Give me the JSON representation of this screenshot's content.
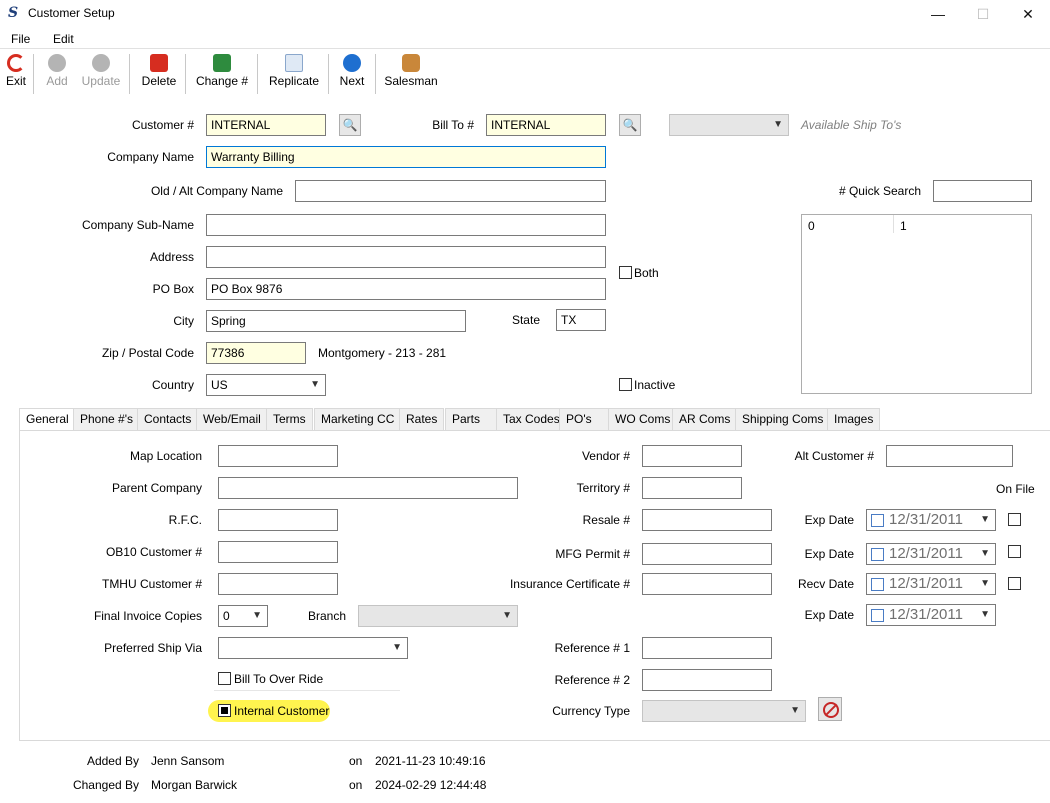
{
  "window": {
    "title": "Customer Setup",
    "app_icon": "S"
  },
  "window_controls": {
    "minimize": "—",
    "maximize": "☐",
    "close": "✕"
  },
  "menu": {
    "file": "File",
    "edit": "Edit"
  },
  "toolbar": {
    "exit": "Exit",
    "add": "Add",
    "update": "Update",
    "delete": "Delete",
    "change": "Change #",
    "replicate": "Replicate",
    "next": "Next",
    "salesman": "Salesman"
  },
  "header": {
    "customer_no_label": "Customer #",
    "customer_no": "INTERNAL",
    "bill_to_label": "Bill To #",
    "bill_to": "INTERNAL",
    "ship_tos_hint": "Available Ship To's",
    "company_name_label": "Company Name",
    "company_name": "Warranty Billing",
    "old_alt_label": "Old / Alt Company Name",
    "old_alt": "",
    "quick_search_label": "# Quick Search",
    "quick_search": "",
    "sub_name_label": "Company Sub-Name",
    "sub_name": "",
    "address_label": "Address",
    "address": "",
    "both_label": "Both",
    "po_box_label": "PO Box",
    "po_box": "PO Box 9876",
    "city_label": "City",
    "city": "Spring",
    "state_label": "State",
    "state": "TX",
    "zip_label": "Zip / Postal Code",
    "zip": "77386",
    "county_info": "Montgomery - 213 - 281",
    "country_label": "Country",
    "country": "US",
    "inactive_label": "Inactive",
    "list_col1": "0",
    "list_col2": "1"
  },
  "tabs": [
    "General",
    "Phone #'s",
    "Contacts",
    "Web/Email",
    "Terms",
    "Marketing CC",
    "Rates",
    "Parts",
    "Tax Codes",
    "PO's",
    "WO Coms",
    "AR Coms",
    "Shipping Coms",
    "Images"
  ],
  "general": {
    "map_location": "Map Location",
    "parent_company": "Parent Company",
    "rfc": "R.F.C.",
    "ob10": "OB10 Customer #",
    "tmhu": "TMHU Customer #",
    "final_invoice_copies": "Final Invoice Copies",
    "final_invoice_value": "0",
    "branch": "Branch",
    "preferred_ship_via": "Preferred Ship Via",
    "bill_to_override": "Bill To Over Ride",
    "internal_customer": "Internal Customer",
    "vendor": "Vendor #",
    "territory": "Territory #",
    "resale": "Resale #",
    "mfg_permit": "MFG Permit #",
    "insurance": "Insurance Certificate #",
    "ref1": "Reference # 1",
    "ref2": "Reference # 2",
    "currency_type": "Currency Type",
    "alt_customer": "Alt Customer #",
    "on_file": "On File",
    "exp_date": "Exp Date",
    "recv_date": "Recv Date",
    "date_value": "12/31/2011"
  },
  "footer": {
    "added_by_label": "Added By",
    "added_by": "Jenn Sansom",
    "changed_by_label": "Changed By",
    "changed_by": "Morgan Barwick",
    "on": "on",
    "added_on": "2021-11-23 10:49:16",
    "changed_on": "2024-02-29 12:44:48"
  },
  "colors": {
    "highlight": "#fff44f",
    "required_field": "#ffffe1",
    "focus": "#0078d7"
  }
}
